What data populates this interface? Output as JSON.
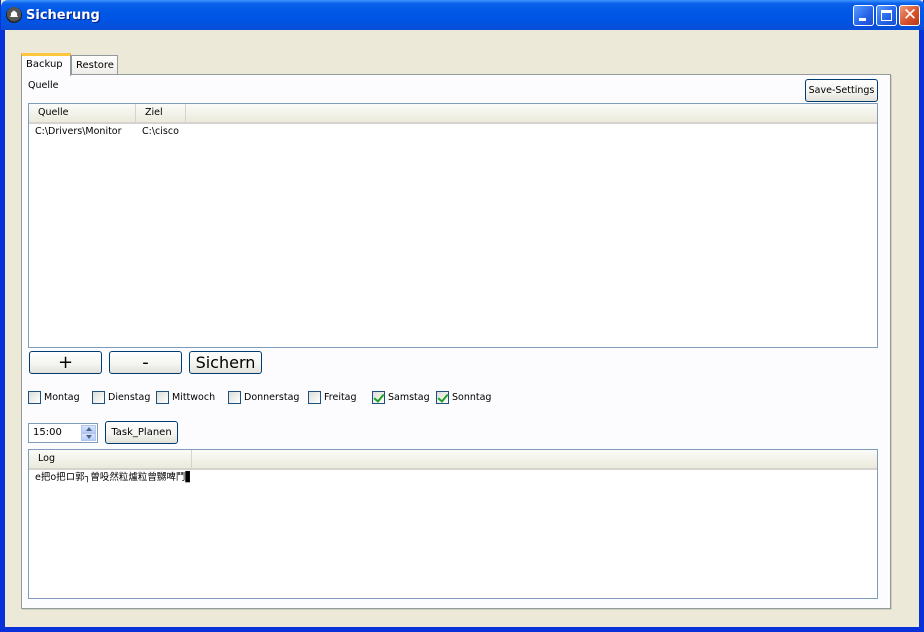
{
  "window": {
    "title": "Sicherung",
    "icon": "app-triangle-icon",
    "controls": {
      "minimize": "minimize-icon",
      "maximize": "maximize-icon",
      "close": "close-icon"
    }
  },
  "tabs": [
    {
      "label": "Backup",
      "active": true
    },
    {
      "label": "Restore",
      "active": false
    }
  ],
  "backup": {
    "quelle_label": "Quelle",
    "save_settings_label": "Save-Settings",
    "list": {
      "columns": [
        "Quelle",
        "Ziel"
      ],
      "rows": [
        [
          "C:\\Drivers\\Monitor",
          "C:\\cisco"
        ]
      ]
    },
    "buttons": {
      "add": "+",
      "remove": "-",
      "backup": "Sichern"
    },
    "days": [
      {
        "label": "Montag",
        "checked": false
      },
      {
        "label": "Dienstag",
        "checked": false
      },
      {
        "label": "Mittwoch",
        "checked": false
      },
      {
        "label": "Donnerstag",
        "checked": false
      },
      {
        "label": "Freitag",
        "checked": false
      },
      {
        "label": "Samstag",
        "checked": true
      },
      {
        "label": "Sonntag",
        "checked": true
      }
    ],
    "time_value": "15:00",
    "task_button": "Task_Planen",
    "log": {
      "column": "Log",
      "rows": [
        "e把o把ロ郭┐曽吺然粒爐粒曾嬲啤鬥▋"
      ]
    }
  },
  "colors": {
    "title_bar": "#0054e3",
    "tab_accent": "#ffc83c",
    "check_mark": "#21a121",
    "border": "#7f9db9"
  }
}
